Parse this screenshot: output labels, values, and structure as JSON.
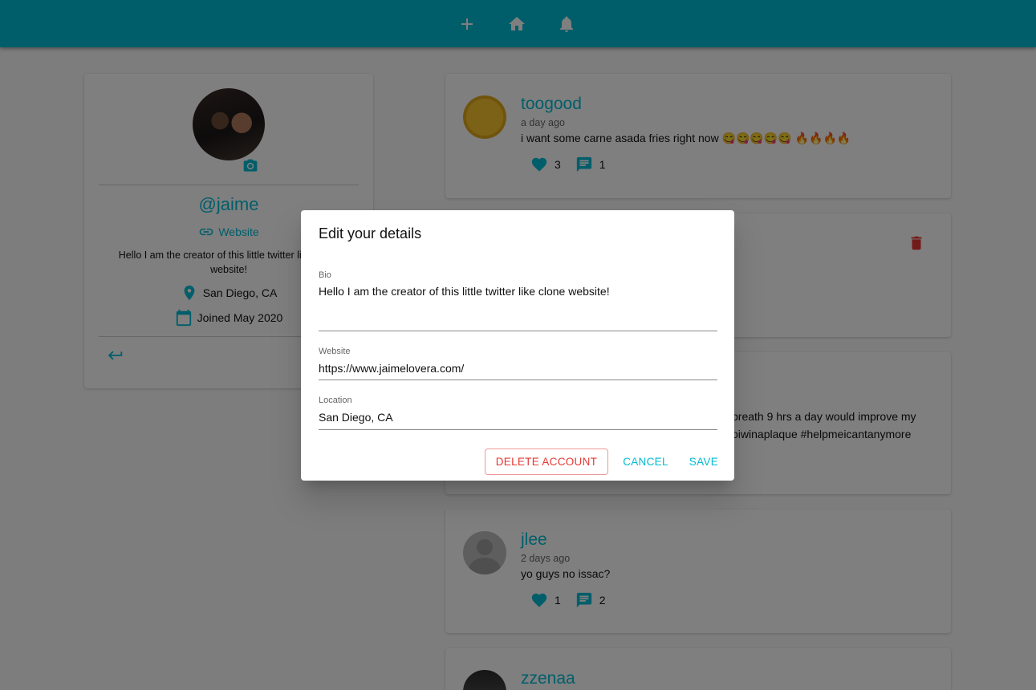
{
  "navbar": {
    "icons": [
      "add-icon",
      "home-icon",
      "notifications-icon"
    ],
    "color": "#00bcd4"
  },
  "profile": {
    "handle": "@jaime",
    "website_label": "Website",
    "bio": "Hello I am the creator of this little twitter like clone website!",
    "location": "San Diego, CA",
    "joined": "Joined May 2020"
  },
  "screams": [
    {
      "username": "toogood",
      "time": "a day ago",
      "body": "i want some carne asada fries right now 😋😋😋😋😋 🔥🔥🔥🔥",
      "likes": "3",
      "comments": "1"
    },
    {
      "partial_line1": "breath 9 hrs a day would improve my",
      "partial_line2": "oiwinaplaque #helpmeicantanymore"
    },
    {
      "username": "jlee",
      "time": "2 days ago",
      "body": "yo guys no issac?",
      "likes": "1",
      "comments": "2"
    },
    {
      "username": "zzenaa"
    }
  ],
  "dialog": {
    "title": "Edit your details",
    "bio_label": "Bio",
    "bio_value": "Hello I am the creator of this little twitter like clone website!",
    "website_label": "Website",
    "website_value": "https://www.jaimelovera.com/",
    "location_label": "Location",
    "location_value": "San Diego, CA",
    "delete_label": "DELETE ACCOUNT",
    "cancel_label": "CANCEL",
    "save_label": "SAVE"
  },
  "colors": {
    "accent": "#00bcd4",
    "danger": "#e53935"
  }
}
